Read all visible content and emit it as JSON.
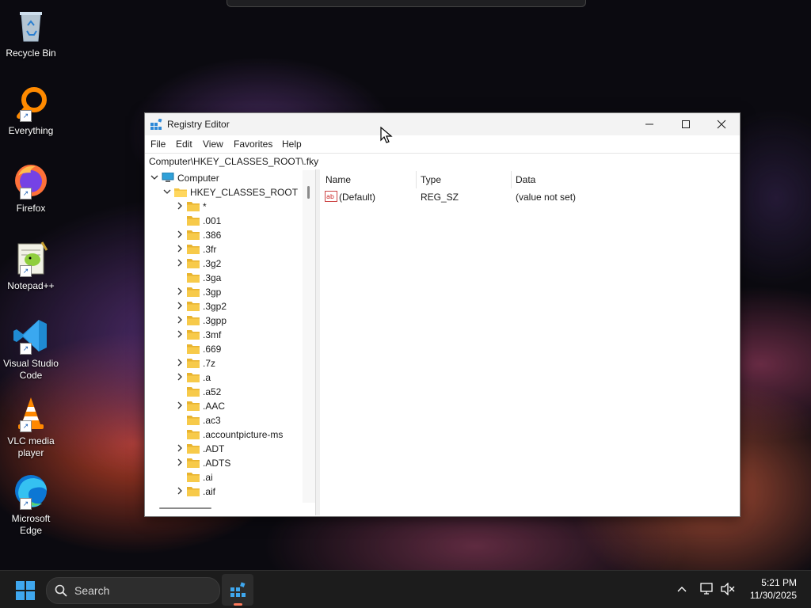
{
  "desktop": {
    "icons": [
      {
        "label": "Recycle Bin"
      },
      {
        "label": "Everything"
      },
      {
        "label": "Firefox"
      },
      {
        "label": "Notepad++"
      },
      {
        "label": "Visual Studio Code"
      },
      {
        "label": "VLC media player"
      },
      {
        "label": "Microsoft Edge"
      }
    ]
  },
  "window": {
    "title": "Registry Editor",
    "menu": [
      "File",
      "Edit",
      "View",
      "Favorites",
      "Help"
    ],
    "address": "Computer\\HKEY_CLASSES_ROOT\\.fky",
    "tree": {
      "root": "Computer",
      "hive": "HKEY_CLASSES_ROOT",
      "keys": [
        {
          "name": "*",
          "expandable": true
        },
        {
          "name": ".001",
          "expandable": false
        },
        {
          "name": ".386",
          "expandable": true
        },
        {
          "name": ".3fr",
          "expandable": true
        },
        {
          "name": ".3g2",
          "expandable": true
        },
        {
          "name": ".3ga",
          "expandable": false
        },
        {
          "name": ".3gp",
          "expandable": true
        },
        {
          "name": ".3gp2",
          "expandable": true
        },
        {
          "name": ".3gpp",
          "expandable": true
        },
        {
          "name": ".3mf",
          "expandable": true
        },
        {
          "name": ".669",
          "expandable": false
        },
        {
          "name": ".7z",
          "expandable": true
        },
        {
          "name": ".a",
          "expandable": true
        },
        {
          "name": ".a52",
          "expandable": false
        },
        {
          "name": ".AAC",
          "expandable": true
        },
        {
          "name": ".ac3",
          "expandable": false
        },
        {
          "name": ".accountpicture-ms",
          "expandable": false
        },
        {
          "name": ".ADT",
          "expandable": true
        },
        {
          "name": ".ADTS",
          "expandable": true
        },
        {
          "name": ".ai",
          "expandable": false
        },
        {
          "name": ".aif",
          "expandable": true
        }
      ]
    },
    "list": {
      "columns": [
        "Name",
        "Type",
        "Data"
      ],
      "rows": [
        {
          "name": "(Default)",
          "type": "REG_SZ",
          "data": "(value not set)"
        }
      ]
    }
  },
  "taskbar": {
    "search_placeholder": "Search",
    "time": "5:21 PM",
    "date": "11/30/2025"
  },
  "colors": {
    "accent": "#0078d4",
    "folder": "#f4c542",
    "taskbar": "#1c1c1c"
  }
}
